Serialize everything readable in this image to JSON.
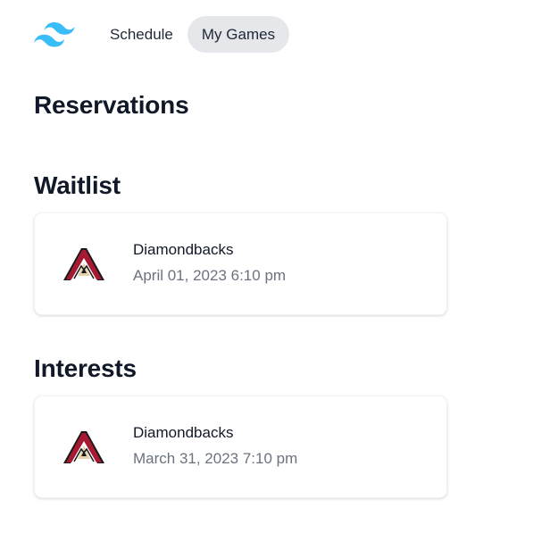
{
  "nav": {
    "items": [
      {
        "label": "Schedule",
        "active": false
      },
      {
        "label": "My Games",
        "active": true
      }
    ],
    "accent_color": "#38bdf8"
  },
  "sections": {
    "reservations": {
      "title": "Reservations",
      "games": []
    },
    "waitlist": {
      "title": "Waitlist",
      "games": [
        {
          "team": "Diamondbacks",
          "datetime": "April 01, 2023 6:10 pm",
          "icon": "diamondbacks-logo-icon"
        }
      ]
    },
    "interests": {
      "title": "Interests",
      "games": [
        {
          "team": "Diamondbacks",
          "datetime": "March 31, 2023 7:10 pm",
          "icon": "diamondbacks-logo-icon"
        }
      ]
    }
  },
  "colors": {
    "diamondbacks_red": "#a71930",
    "diamondbacks_black": "#1a1a1a",
    "diamondbacks_sand": "#e3d4ad"
  }
}
